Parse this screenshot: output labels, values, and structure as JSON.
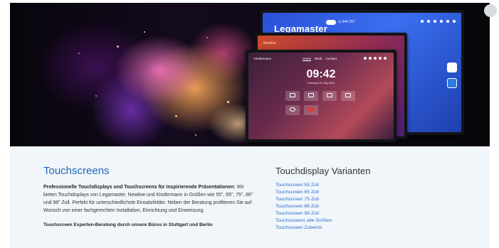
{
  "hero": {
    "back_monitor": {
      "brand": "Legamaster",
      "status": "⊙ 344 257"
    },
    "middle_monitor": {
      "label": "Newline"
    },
    "front_monitor": {
      "logo": "Kindermann",
      "nav": [
        "Home",
        "Work",
        "Contact"
      ],
      "clock": "09:42",
      "date": "Tuesday 20 July 2021"
    }
  },
  "left": {
    "title": "Touchscreens",
    "intro_bold": "Professionelle Touchdisplays und Touchscreens für inspirierende Präsentationen:",
    "intro_text": " Wir bieten Touchdisplays von Legamaster, Newline und Kindermann in Größen wie 55\", 65\", 75\", 86\" und 98\" Zoll. Perfekt für unterschiedlichste Einsatzfelder. Neben der Beratung profitieren Sie auf Wunsch von einer fachgerechten Installation, Einrichtung und Einweisung.",
    "subheading": "Touchscreen Experten-Beratung durch unsere Büros in Stuttgart und Berlin"
  },
  "right": {
    "title": "Touchdisplay Varianten",
    "links": [
      "Touchscreen 55 Zoll",
      "Touchscreen 65 Zoll",
      "Touchscreen 75 Zoll",
      "Touchscreen 86 Zoll",
      "Touchscreen 98 Zoll",
      "Touchscreens alle Größen",
      "Touchscreen Zubehör"
    ]
  },
  "colors": {
    "heading_blue": "#1e64b8",
    "link_blue": "#2d6fc9",
    "section_bg": "#f1f6fb"
  },
  "icons": [
    "carousel-next-icon",
    "app-tile-icon",
    "google-drive-icon",
    "settings-icon"
  ]
}
